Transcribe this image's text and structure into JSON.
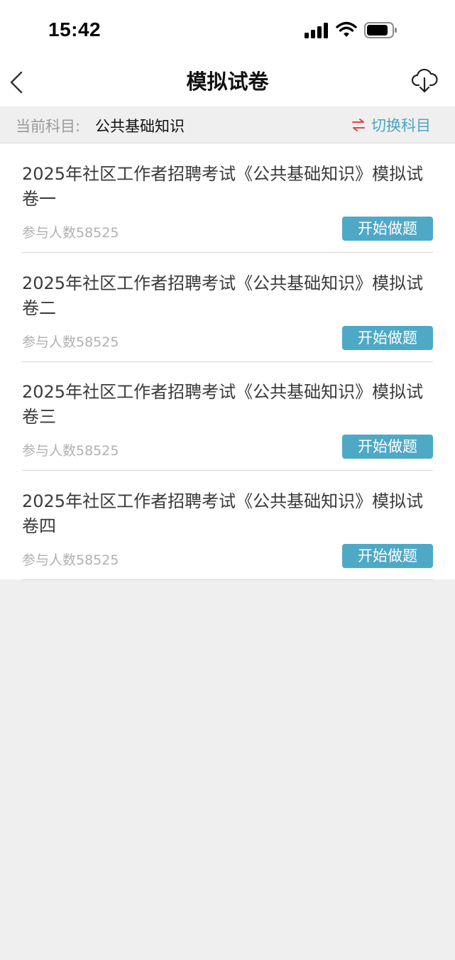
{
  "status_bar": {
    "time": "15:42",
    "icons": [
      "signal-icon",
      "wifi-icon",
      "battery-icon"
    ]
  },
  "nav": {
    "title": "模拟试卷",
    "back_icon": "chevron-left-icon",
    "download_icon": "cloud-download-icon"
  },
  "subject": {
    "label": "当前科目:",
    "value": "公共基础知识",
    "switch_label": "切换科目",
    "switch_icon": "swap-arrows-icon"
  },
  "papers": [
    {
      "title": "2025年社区工作者招聘考试《公共基础知识》模拟试卷一",
      "participants": "参与人数58525",
      "button": "开始做题"
    },
    {
      "title": "2025年社区工作者招聘考试《公共基础知识》模拟试卷二",
      "participants": "参与人数58525",
      "button": "开始做题"
    },
    {
      "title": "2025年社区工作者招聘考试《公共基础知识》模拟试卷三",
      "participants": "参与人数58525",
      "button": "开始做题"
    },
    {
      "title": "2025年社区工作者招聘考试《公共基础知识》模拟试卷四",
      "participants": "参与人数58525",
      "button": "开始做题"
    }
  ],
  "colors": {
    "accent": "#4ea9c6",
    "swap_icon_red": "#e0483e",
    "background": "#efefef"
  }
}
